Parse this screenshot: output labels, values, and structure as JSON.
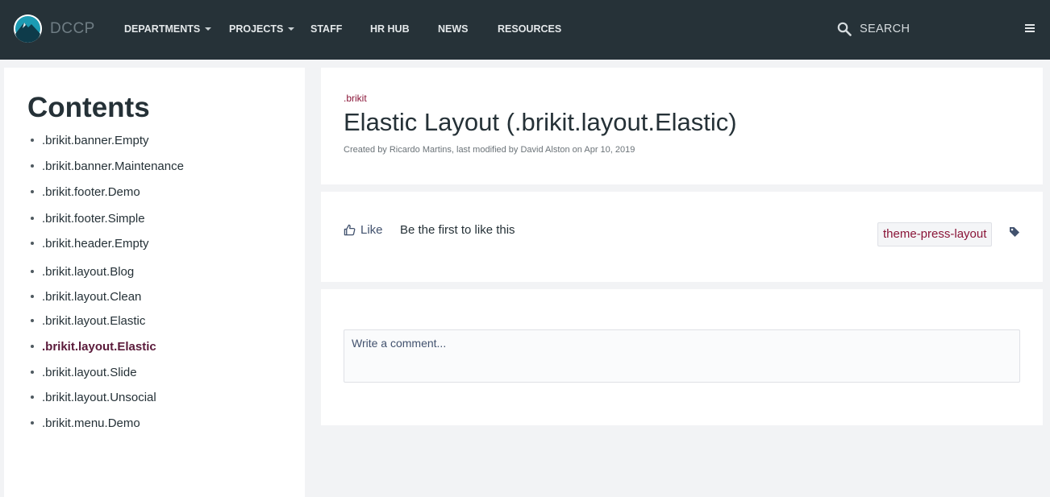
{
  "header": {
    "brand": "DCCP",
    "nav": [
      {
        "label": "DEPARTMENTS",
        "has_dropdown": true
      },
      {
        "label": "PROJECTS",
        "has_dropdown": true
      },
      {
        "label": "STAFF",
        "has_dropdown": false
      },
      {
        "label": "HR HUB",
        "has_dropdown": false
      },
      {
        "label": "NEWS",
        "has_dropdown": false
      },
      {
        "label": "RESOURCES",
        "has_dropdown": false
      }
    ],
    "search_label": "SEARCH",
    "icons": {
      "logo": "dccp-logo",
      "search": "search-icon",
      "menu": "hamburger-menu-icon"
    }
  },
  "sidebar": {
    "title": "Contents",
    "items": [
      {
        "label": ".brikit.banner.Empty",
        "active": false
      },
      {
        "label": ".brikit.banner.Maintenance",
        "active": false
      },
      {
        "label": ".brikit.footer.Demo",
        "active": false
      },
      {
        "label": ".brikit.footer.Simple",
        "active": false
      },
      {
        "label": ".brikit.header.Empty",
        "active": false
      },
      {
        "label": ".brikit.layout.Blog",
        "active": false
      },
      {
        "label": ".brikit.layout.Clean",
        "active": false
      },
      {
        "label": ".brikit.layout.Elastic",
        "active": false
      },
      {
        "label": ".brikit.layout.Elastic",
        "active": true
      },
      {
        "label": ".brikit.layout.Slide",
        "active": false
      },
      {
        "label": ".brikit.layout.Unsocial",
        "active": false
      },
      {
        "label": ".brikit.menu.Demo",
        "active": false
      }
    ]
  },
  "page": {
    "breadcrumb": ".brikit",
    "title": "Elastic Layout (.brikit.layout.Elastic)",
    "byline": "Created by Ricardo Martins, last modified by David Alston on Apr 10, 2019"
  },
  "like_bar": {
    "like_label": "Like",
    "like_text": "Be the first to like this",
    "label_tag": "theme-press-layout",
    "icons": {
      "like": "thumbs-up-icon",
      "tag": "tag-icon"
    }
  },
  "comment": {
    "placeholder": "Write a comment..."
  },
  "colors": {
    "topbar": "#263238",
    "accent": "#8a1538",
    "active_item": "#5a1a3a",
    "background": "#f2f3f5"
  }
}
